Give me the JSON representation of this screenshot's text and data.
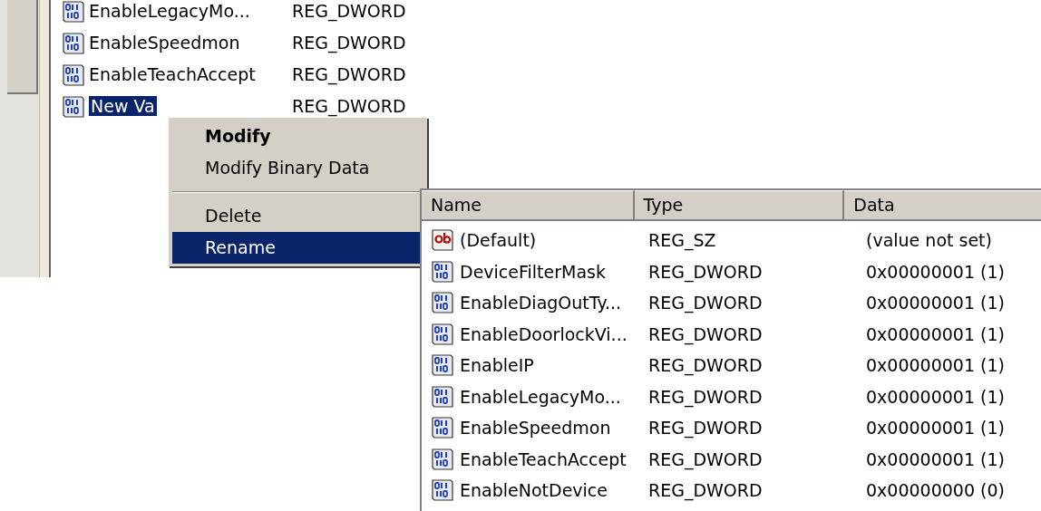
{
  "back_list": {
    "rows": [
      {
        "name": "EnableLegacyMo...",
        "type": "REG_DWORD",
        "kind": "dword",
        "selected": false
      },
      {
        "name": "EnableSpeedmon",
        "type": "REG_DWORD",
        "kind": "dword",
        "selected": false
      },
      {
        "name": "EnableTeachAccept",
        "type": "REG_DWORD",
        "kind": "dword",
        "selected": false
      },
      {
        "name": "New Va",
        "type": "REG_DWORD",
        "kind": "dword",
        "selected": true
      }
    ]
  },
  "context_menu": {
    "items": [
      {
        "kind": "item",
        "label": "Modify",
        "default": true,
        "selected": false
      },
      {
        "kind": "item",
        "label": "Modify Binary Data",
        "default": false,
        "selected": false
      },
      {
        "kind": "separator"
      },
      {
        "kind": "item",
        "label": "Delete",
        "default": false,
        "selected": false
      },
      {
        "kind": "item",
        "label": "Rename",
        "default": false,
        "selected": true
      }
    ]
  },
  "values_list": {
    "columns": [
      "Name",
      "Type",
      "Data"
    ],
    "rows": [
      {
        "kind": "string",
        "name": "(Default)",
        "type": "REG_SZ",
        "data": "(value not set)"
      },
      {
        "kind": "dword",
        "name": "DeviceFilterMask",
        "type": "REG_DWORD",
        "data": "0x00000001 (1)"
      },
      {
        "kind": "dword",
        "name": "EnableDiagOutTy...",
        "type": "REG_DWORD",
        "data": "0x00000001 (1)"
      },
      {
        "kind": "dword",
        "name": "EnableDoorlockVi...",
        "type": "REG_DWORD",
        "data": "0x00000001 (1)"
      },
      {
        "kind": "dword",
        "name": "EnableIP",
        "type": "REG_DWORD",
        "data": "0x00000001 (1)"
      },
      {
        "kind": "dword",
        "name": "EnableLegacyMo...",
        "type": "REG_DWORD",
        "data": "0x00000001 (1)"
      },
      {
        "kind": "dword",
        "name": "EnableSpeedmon",
        "type": "REG_DWORD",
        "data": "0x00000001 (1)"
      },
      {
        "kind": "dword",
        "name": "EnableTeachAccept",
        "type": "REG_DWORD",
        "data": "0x00000001 (1)"
      },
      {
        "kind": "dword",
        "name": "EnableNotDevice",
        "type": "REG_DWORD",
        "data": "0x00000000 (0)"
      }
    ]
  }
}
